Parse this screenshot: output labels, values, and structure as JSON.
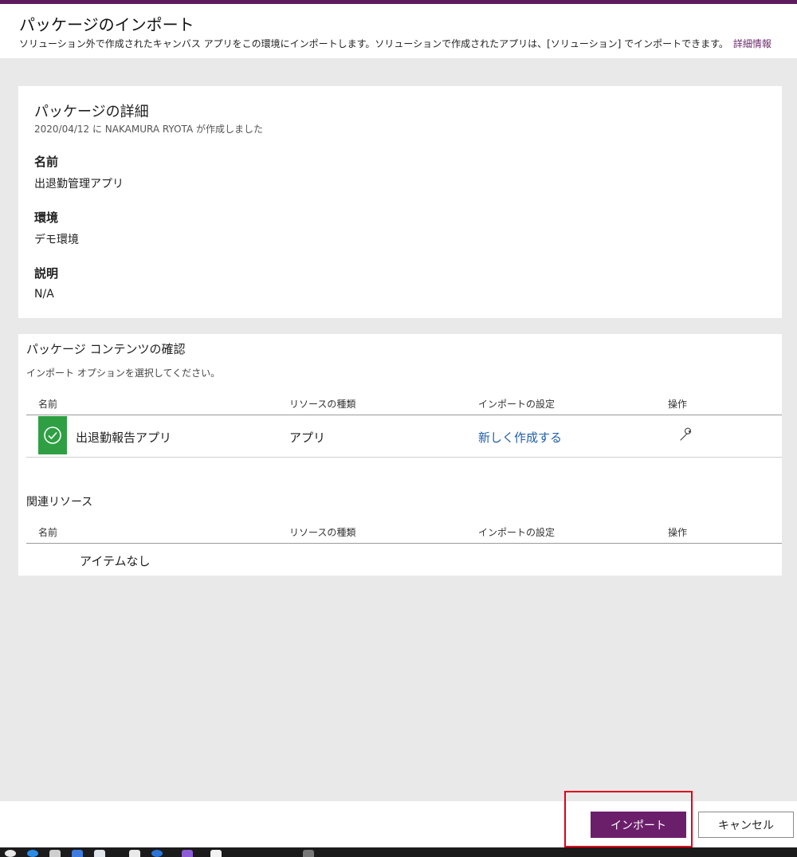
{
  "header": {
    "title": "パッケージのインポート",
    "description": "ソリューション外で作成されたキャンバス アプリをこの環境にインポートします。ソリューションで作成されたアプリは、[ソリューション] でインポートできます。",
    "learn_more": "詳細情報"
  },
  "details": {
    "title": "パッケージの詳細",
    "created": "2020/04/12 に NAKAMURA RYOTA が作成しました",
    "name_label": "名前",
    "name_value": "出退勤管理アプリ",
    "env_label": "環境",
    "env_value": "デモ環境",
    "desc_label": "説明",
    "desc_value": "N/A"
  },
  "contents": {
    "title": "パッケージ コンテンツの確認",
    "subtitle": "インポート オプションを選択してください。",
    "columns": [
      "名前",
      "リソースの種類",
      "インポートの設定",
      "操作"
    ],
    "rows": [
      {
        "name": "出退勤報告アプリ",
        "type": "アプリ",
        "setting": "新しく作成する",
        "status": "check-icon",
        "op": "wrench-icon"
      }
    ]
  },
  "related": {
    "title": "関連リソース",
    "columns": [
      "名前",
      "リソースの種類",
      "インポートの設定",
      "操作"
    ],
    "empty": "アイテムなし"
  },
  "footer": {
    "import": "インポート",
    "cancel": "キャンセル"
  },
  "colors": {
    "brand": "#6b1f6b",
    "success": "#2ea043",
    "link": "#1f5fa8",
    "highlight": "#e0001b"
  }
}
